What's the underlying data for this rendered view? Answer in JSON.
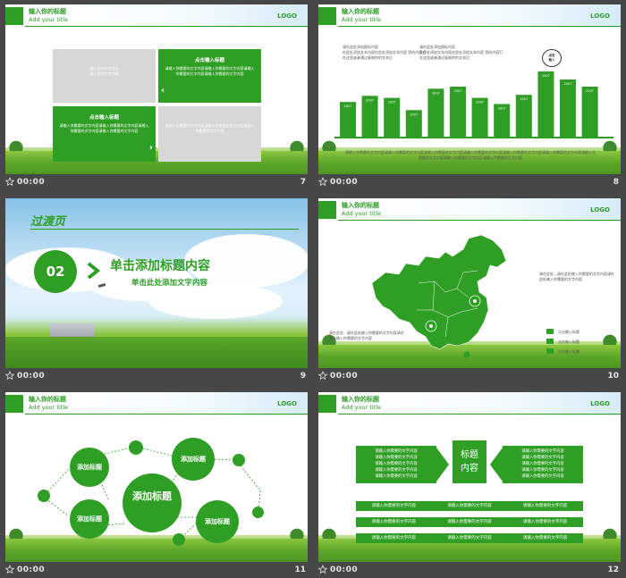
{
  "colors": {
    "accent": "#2e9e24",
    "background": "#474747",
    "meta_text": "#e6e6e6"
  },
  "icons": {
    "slide_marker": "star-icon"
  },
  "common": {
    "header_title": "输入你的标题",
    "header_subtitle": "Add your title",
    "logo": "LOGO",
    "time": "00:00"
  },
  "slides": [
    {
      "number": "7",
      "boxes": [
        {
          "title": "",
          "body": "输入你的文字内容\n输入你的文字内容"
        },
        {
          "title": "点击输入标题",
          "body": "请输入你需要的文字内容请输入你需要的文字内容请输入你需要的文字内容请输入你需要的文字内容"
        },
        {
          "title": "点击输入标题",
          "body": "请输入你需要的文字内容请输入你需要的文字内容请输入你需要的文字内容请输入你需要的文字内容"
        },
        {
          "title": "",
          "body": "请输入你需要的文字内容请输入你需要的文字内容请输入你需要的文字内容"
        }
      ]
    },
    {
      "number": "8",
      "text_left": {
        "title": "请在此处添加图标内容",
        "body": "在此处添加文本内容在此处添加文本内容 您的内容打在这里或者通过复制你的文本后"
      },
      "text_right": {
        "title": "请在此处添加图标内容",
        "body": "在此处添加文本内容在此处添加文本内容 您的内容打在这里或者通过复制你的文本后"
      },
      "bubble": "点击\n输入",
      "bar_label": "2007",
      "footer": "请输入你需要的文字内容请输入你需要的文字内容请输入你需要的文字内容请输入你需要的文字内容请输入你需要的文字内容请输入你需要的文字内容请输入你需要的文字内容请输入你需要的文字内容请输入你需要的文字内容"
    },
    {
      "number": "9",
      "title": "过渡页",
      "badge": "02",
      "heading": "单击添加标题内容",
      "subheading": "单击此处添加文字内容"
    },
    {
      "number": "10",
      "text_right": "请在此处...请在此处输入你需要的文字内容请在此处输入你需要的文字内容",
      "text_left": "请在此处...请在此处输入你需要的文字内容请在此处输入你需要的文字内容",
      "legend": [
        "点击输入标题",
        "点击输入标题",
        "点击输入标题"
      ]
    },
    {
      "number": "11",
      "center": "添加标题",
      "nodes": [
        "添加标题",
        "添加标题",
        "添加标题",
        "添加标题"
      ]
    },
    {
      "number": "12",
      "center": "标题\n内容",
      "side_text": "请输入你需要的文字内容",
      "row_text": "请输入你需要的文字内容"
    }
  ],
  "chart_data": {
    "type": "bar",
    "categories": [
      "2007",
      "2007",
      "2007",
      "2007",
      "2007",
      "2007",
      "2007",
      "2007",
      "2007",
      "2007",
      "2007",
      "2007"
    ],
    "values": [
      34,
      40,
      38,
      26,
      47,
      49,
      38,
      32,
      41,
      64,
      56,
      49
    ],
    "ylim": [
      0,
      70
    ],
    "grid": false
  }
}
